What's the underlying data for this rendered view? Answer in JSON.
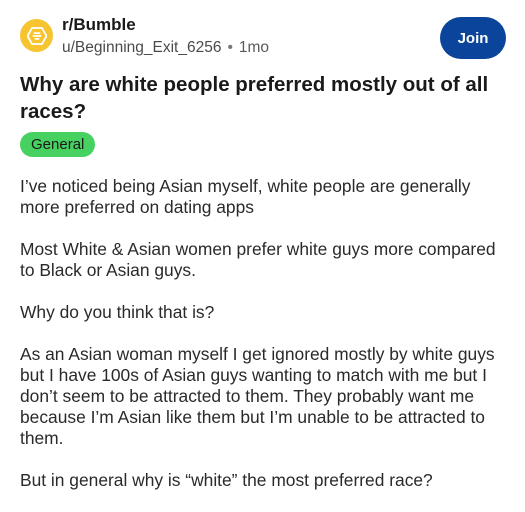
{
  "post": {
    "subreddit": "r/Bumble",
    "author": "u/Beginning_Exit_6256",
    "separator": "•",
    "age": "1mo",
    "join_label": "Join",
    "title": "Why are white people preferred mostly out of all races?",
    "flair": "General",
    "flair_color": "#46d160",
    "avatar_color": "#f5c42f",
    "avatar_icon": "bumble-logo-icon",
    "join_color": "#0a449b",
    "paragraphs": [
      "I’ve noticed being Asian myself, white people are generally more preferred on dating apps",
      "Most White & Asian women prefer white guys more compared to Black or Asian guys.",
      "Why do you think that is?",
      "As an Asian woman myself I get ignored mostly by white guys but I have 100s of Asian guys wanting to match with me but I don’t seem to be attracted to them. They probably want me because I’m Asian like them but I’m unable to be attracted to them.",
      "But in general why is “white” the most preferred race?"
    ]
  }
}
